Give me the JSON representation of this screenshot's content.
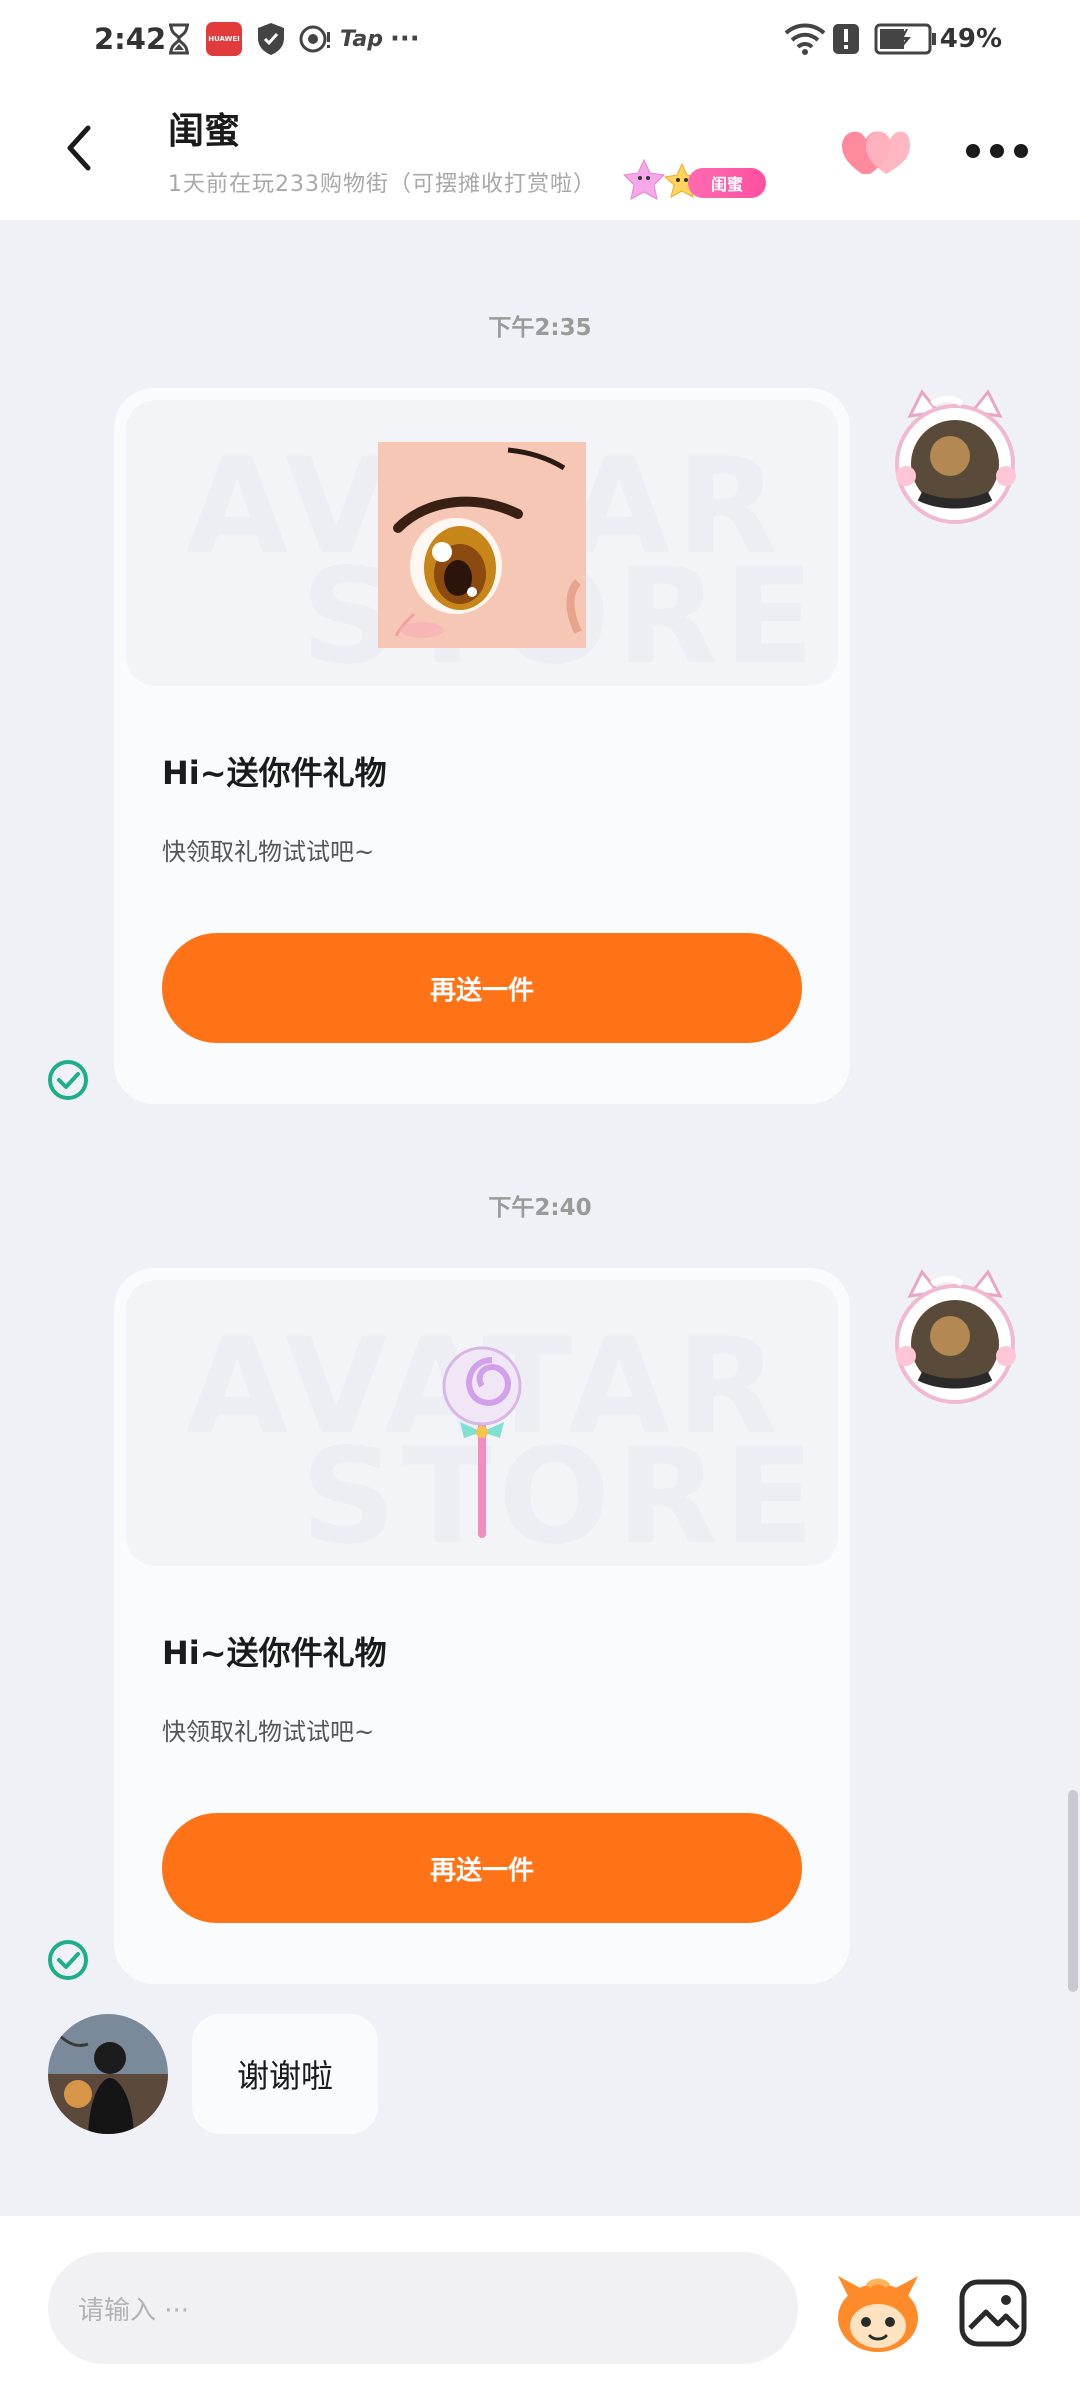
{
  "status_bar": {
    "time": "2:42",
    "app_badge": "HUAWEI",
    "tap_label": "Tap",
    "more": "···",
    "battery_percent": "49%"
  },
  "header": {
    "title": "闺蜜",
    "subtitle": "1天前在玩233购物街（可摆摊收打赏啦）",
    "relation_tag": "闺蜜"
  },
  "messages": [
    {
      "time": "下午2:35",
      "watermark": [
        "AVATAR",
        "STORE"
      ],
      "gift_icon": "anime-eye",
      "title": "Hi~送你件礼物",
      "desc": "快领取礼物试试吧~",
      "button": "再送一件"
    },
    {
      "time": "下午2:40",
      "watermark": [
        "AVATAR",
        "STORE"
      ],
      "gift_icon": "lollipop",
      "title": "Hi~送你件礼物",
      "desc": "快领取礼物试试吧~",
      "button": "再送一件"
    }
  ],
  "incoming": {
    "text": "谢谢啦"
  },
  "input": {
    "placeholder": "请输入 ···"
  },
  "colors": {
    "accent": "#FF7316",
    "check": "#1DAE8A",
    "background": "#EFF1F7",
    "heart": "#FF7A8E"
  }
}
